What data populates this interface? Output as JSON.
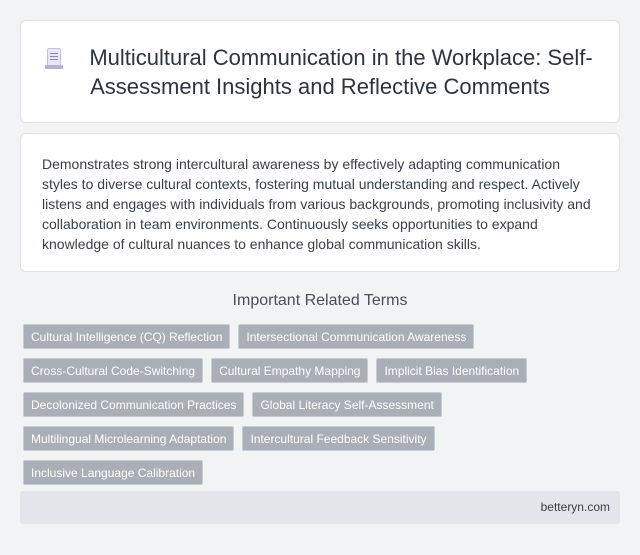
{
  "header": {
    "icon": "document-icon",
    "title": "Multicultural Communication in the Workplace: Self-Assessment Insights and Reflective Comments"
  },
  "summary": {
    "text": "Demonstrates strong intercultural awareness by effectively adapting communication styles to diverse cultural contexts, fostering mutual understanding and respect. Actively listens and engages with individuals from various backgrounds, promoting inclusivity and collaboration in team environments. Continuously seeks opportunities to expand knowledge of cultural nuances to enhance global communication skills."
  },
  "related": {
    "heading": "Important Related Terms",
    "tags": [
      "Cultural Intelligence (CQ) Reflection",
      "Intersectional Communication Awareness",
      "Cross-Cultural Code-Switching",
      "Cultural Empathy Mapping",
      "Implicit Bias Identification",
      "Decolonized Communication Practices",
      "Global Literacy Self-Assessment",
      "Multilingual Microlearning Adaptation",
      "Intercultural Feedback Sensitivity",
      "Inclusive Language Calibration"
    ]
  },
  "footer": {
    "site": "betteryn.com"
  }
}
